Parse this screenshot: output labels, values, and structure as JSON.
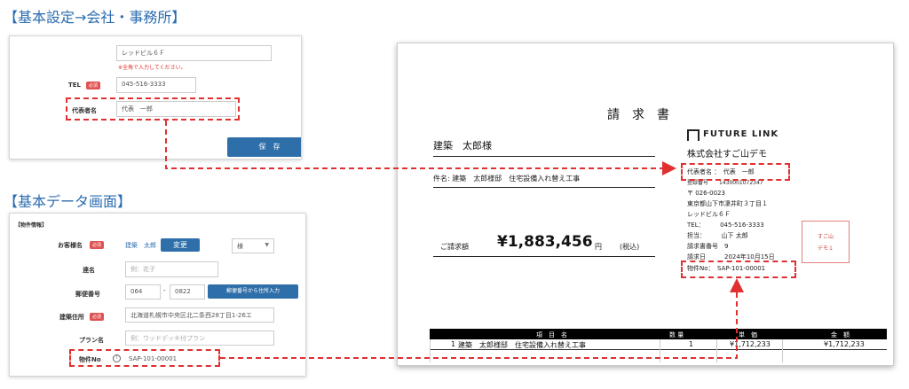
{
  "headings": {
    "company": "【基本設定→会社・事務所】",
    "basic": "【基本データ画面】"
  },
  "company_form": {
    "building_value": "レッドビル６Ｆ",
    "zenkaku_note": "※全角で入力してください。",
    "tel_label": "TEL",
    "required": "必須",
    "tel_value": "045-516-3333",
    "rep_label": "代表者名",
    "rep_value": "代表　一郎",
    "save_label": "保　存"
  },
  "basic_form": {
    "section": "【物件情報】",
    "customer_label": "お客様名",
    "customer_value": "建築　太郎",
    "change_label": "変更",
    "honorific": "様",
    "mei_label": "連名",
    "mei_placeholder": "例：花子",
    "zip_label": "郵便番号",
    "zip1": "064",
    "zip_sep": "-",
    "zip2": "0822",
    "zip_button": "郵便番号から住所入力",
    "address_label": "建築住所",
    "address_value": "北海道札幌市中央区北二条西28丁目1-26エ",
    "plan_label": "プラン名",
    "plan_placeholder": "例：ウッドデッキ付プラン",
    "property_label": "物件No",
    "property_help": "?",
    "property_value": "SAP-101-00001"
  },
  "invoice": {
    "title": "請　求　書",
    "customer": "建築　太郎様",
    "subject": "件名: 建築　太郎様邸　住宅設備入れ替え工事",
    "total_label": "ご請求額",
    "total_amount": "¥1,883,456",
    "total_suffix": "円",
    "tax_note": "(税込)",
    "logo_text": "FUTURE LINK",
    "company": "株式会社すご山デモ",
    "rep": "代表者名 ：　代表　一郎",
    "reg_no": "登録番号　　1430001072347",
    "postal": "〒 026-0023",
    "address1": "東京都山下市凄井町３丁目１",
    "address2": "レッドビル６Ｆ",
    "tel": "TEL：　　　045-516-3333",
    "person": "担当：　　　山下 太郎",
    "invoice_no": "請求書番号　9",
    "date": "請求日　　　2024年10月15日",
    "property": "物件No：　SAP-101-00001",
    "stamp_line1": "すご山",
    "stamp_line2": "デモ１",
    "table_headers": [
      "項　目　名",
      "数 量",
      "単　価",
      "金　額"
    ],
    "row": {
      "no": "1",
      "item": "建築　太郎様邸　住宅設備入れ替え工事",
      "qty": "1",
      "price": "¥1,712,233",
      "amount": "¥1,712,233"
    }
  },
  "colors": {
    "heading": "#2b6cb0",
    "required_badge": "#e05252",
    "button": "#2f6fa9",
    "callout": "#e03030"
  },
  "icons": [
    "logo-mark-icon",
    "chevron-down-icon",
    "help-icon",
    "arrow-icon"
  ]
}
